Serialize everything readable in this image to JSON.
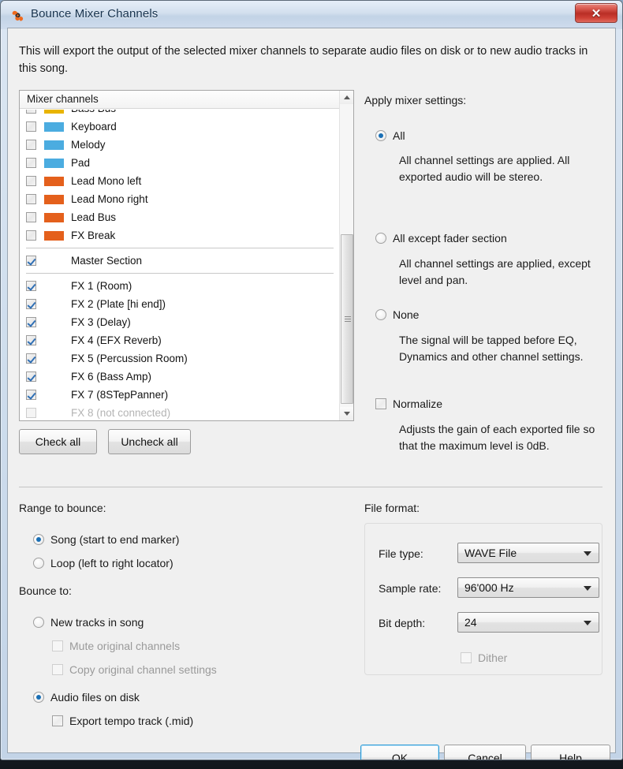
{
  "window": {
    "title": "Bounce Mixer Channels",
    "icon": "propeller-logo-icon",
    "close_label": "✕"
  },
  "intro": "This will export the output of the selected mixer channels to separate audio files on disk or to new audio tracks in this song.",
  "channel_list": {
    "header": "Mixer channels",
    "rows": [
      {
        "label": "Bass Bus",
        "checked": false,
        "color": "#E8B400",
        "disabled": false,
        "separator_after": false
      },
      {
        "label": "Keyboard",
        "checked": false,
        "color": "#4BACE0",
        "disabled": false,
        "separator_after": false
      },
      {
        "label": "Melody",
        "checked": false,
        "color": "#4BACE0",
        "disabled": false,
        "separator_after": false
      },
      {
        "label": "Pad",
        "checked": false,
        "color": "#4BACE0",
        "disabled": false,
        "separator_after": false
      },
      {
        "label": "Lead Mono left",
        "checked": false,
        "color": "#E4601C",
        "disabled": false,
        "separator_after": false
      },
      {
        "label": "Lead Mono right",
        "checked": false,
        "color": "#E4601C",
        "disabled": false,
        "separator_after": false
      },
      {
        "label": "Lead Bus",
        "checked": false,
        "color": "#E4601C",
        "disabled": false,
        "separator_after": false
      },
      {
        "label": "FX Break",
        "checked": false,
        "color": "#E4601C",
        "disabled": false,
        "separator_after": true
      },
      {
        "label": "Master Section",
        "checked": true,
        "color": null,
        "disabled": false,
        "separator_after": true
      },
      {
        "label": "FX 1 (Room)",
        "checked": true,
        "color": null,
        "disabled": false,
        "separator_after": false
      },
      {
        "label": "FX 2 (Plate [hi end])",
        "checked": true,
        "color": null,
        "disabled": false,
        "separator_after": false
      },
      {
        "label": "FX 3 (Delay)",
        "checked": true,
        "color": null,
        "disabled": false,
        "separator_after": false
      },
      {
        "label": "FX 4 (EFX Reverb)",
        "checked": true,
        "color": null,
        "disabled": false,
        "separator_after": false
      },
      {
        "label": "FX 5 (Percussion Room)",
        "checked": true,
        "color": null,
        "disabled": false,
        "separator_after": false
      },
      {
        "label": "FX 6 (Bass Amp)",
        "checked": true,
        "color": null,
        "disabled": false,
        "separator_after": false
      },
      {
        "label": "FX 7 (8STepPanner)",
        "checked": true,
        "color": null,
        "disabled": false,
        "separator_after": false
      },
      {
        "label": "FX 8 (not connected)",
        "checked": false,
        "color": null,
        "disabled": true,
        "separator_after": false
      }
    ],
    "scrollbar": {
      "up_icon": "chevron-up-icon",
      "down_icon": "chevron-down-icon"
    }
  },
  "buttons": {
    "check_all": "Check all",
    "uncheck_all": "Uncheck all",
    "ok": "OK",
    "cancel": "Cancel",
    "help": "Help"
  },
  "apply_mixer_settings": {
    "label": "Apply mixer settings:",
    "options": [
      {
        "label": "All",
        "selected": true,
        "description": "All channel settings are applied. All exported audio will be stereo."
      },
      {
        "label": "All except fader section",
        "selected": false,
        "description": "All channel settings are applied, except level and pan."
      },
      {
        "label": "None",
        "selected": false,
        "description": "The signal will be tapped before EQ, Dynamics and other channel settings."
      }
    ],
    "normalize": {
      "label": "Normalize",
      "checked": false,
      "description": "Adjusts the gain of each exported file so that the maximum level is 0dB."
    }
  },
  "range_to_bounce": {
    "label": "Range to bounce:",
    "options": [
      {
        "label": "Song (start to end marker)",
        "selected": true
      },
      {
        "label": "Loop (left to right locator)",
        "selected": false
      }
    ]
  },
  "bounce_to": {
    "label": "Bounce to:",
    "options": [
      {
        "label": "New tracks in song",
        "selected": false
      },
      {
        "label": "Audio files on disk",
        "selected": true
      }
    ],
    "new_tracks_children": [
      {
        "label": "Mute original channels",
        "checked": false,
        "disabled": true
      },
      {
        "label": "Copy original channel settings",
        "checked": false,
        "disabled": true
      }
    ],
    "audio_files_children": [
      {
        "label": "Export tempo track (.mid)",
        "checked": false,
        "disabled": false
      }
    ]
  },
  "file_format": {
    "label": "File format:",
    "fields": [
      {
        "label": "File type:",
        "value": "WAVE File"
      },
      {
        "label": "Sample rate:",
        "value": "96'000 Hz"
      },
      {
        "label": "Bit depth:",
        "value": "24"
      }
    ],
    "dither": {
      "label": "Dither",
      "checked": false,
      "disabled": true
    }
  },
  "colors": {
    "accent": "#2e9bd6",
    "radio_dot": "#1a6fb5",
    "check": "#2f6fb5",
    "chip_blue": "#4BACE0",
    "chip_orange": "#E4601C",
    "chip_yellow": "#E8B400",
    "close_red": "#b92e26"
  }
}
